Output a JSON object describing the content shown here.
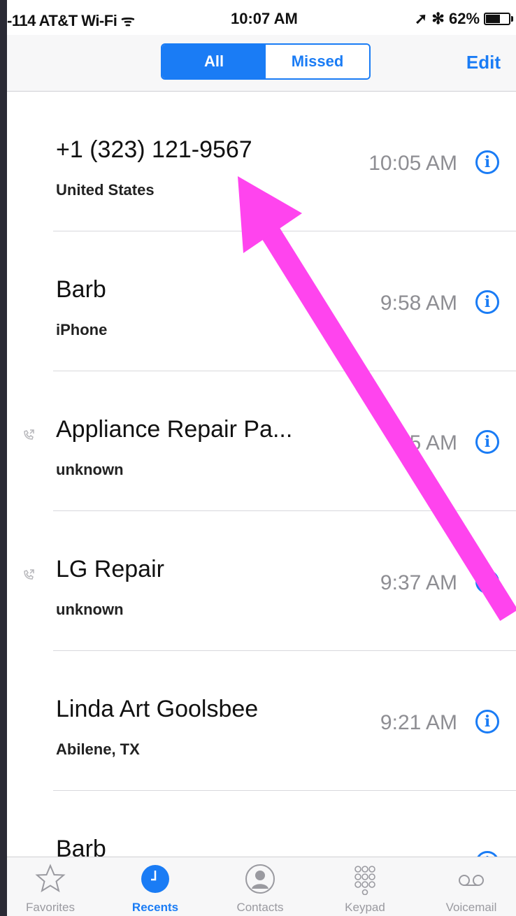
{
  "status": {
    "carrier": "-114 AT&T Wi-Fi ᯤ",
    "time": "10:07 AM",
    "right": "➚ ✻ 62%",
    "battery_percent": 62
  },
  "nav": {
    "seg_all": "All",
    "seg_missed": "Missed",
    "edit": "Edit"
  },
  "calls": [
    {
      "name": "+1 (323) 121-9567",
      "sub": "United States",
      "time": "10:05 AM"
    },
    {
      "name": "Barb",
      "sub": "iPhone",
      "time": "9:58 AM"
    },
    {
      "name": "Appliance Repair Pa...",
      "sub": "unknown",
      "time": "9:5  AM"
    },
    {
      "name": "LG Repair",
      "sub": "unknown",
      "time": "9:37 AM"
    },
    {
      "name": "Linda Art Goolsbee",
      "sub": "Abilene, TX",
      "time": "9:21 AM"
    },
    {
      "name": "Barb",
      "sub": "",
      "time": ""
    }
  ],
  "info_glyph": "i",
  "tabs": [
    {
      "label": "Favorites",
      "icon": "star-icon"
    },
    {
      "label": "Recents",
      "icon": "clock-icon"
    },
    {
      "label": "Contacts",
      "icon": "contact-icon"
    },
    {
      "label": "Keypad",
      "icon": "keypad-icon"
    },
    {
      "label": "Voicemail",
      "icon": "voicemail-icon"
    }
  ],
  "colors": {
    "accent": "#1a7cf5",
    "annotation_arrow": "#ff44ee"
  }
}
